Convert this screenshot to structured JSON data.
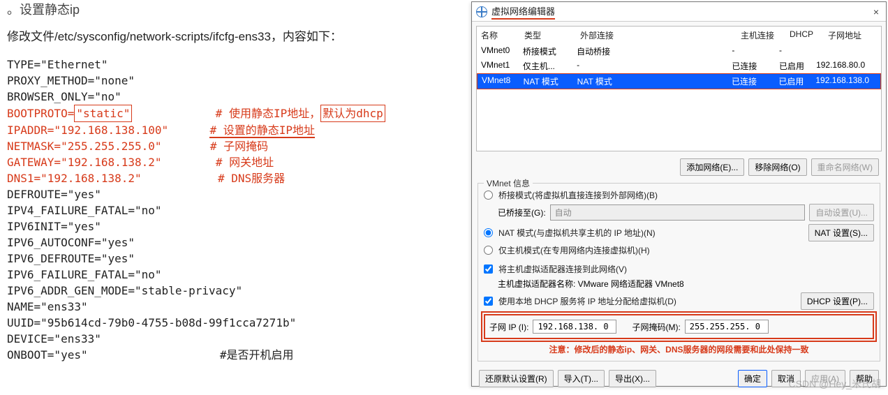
{
  "left": {
    "heading_partial": "设置静态ip",
    "intro": "修改文件/etc/sysconfig/network-scripts/ifcfg-ens33，内容如下：",
    "lines": {
      "l1": "TYPE=\"Ethernet\"",
      "l2": "PROXY_METHOD=\"none\"",
      "l3": "BROWSER_ONLY=\"no\"",
      "l4a": "BOOTPROTO=",
      "l4b": "\"static\"",
      "l4c": "# 使用静态IP地址，",
      "l4d": "默认为dhcp",
      "l5": "IPADDR=\"192.168.138.100\"",
      "l5c": "# 设置的静态IP地址",
      "l6": "NETMASK=\"255.255.255.0\"",
      "l6c": "# 子网掩码",
      "l7": "GATEWAY=\"192.168.138.2\"",
      "l7c": "# 网关地址",
      "l8": "DNS1=\"192.168.138.2\"",
      "l8c": "# DNS服务器",
      "l9": "DEFROUTE=\"yes\"",
      "l10": "IPV4_FAILURE_FATAL=\"no\"",
      "l11": "IPV6INIT=\"yes\"",
      "l12": "IPV6_AUTOCONF=\"yes\"",
      "l13": "IPV6_DEFROUTE=\"yes\"",
      "l14": "IPV6_FAILURE_FATAL=\"no\"",
      "l15": "IPV6_ADDR_GEN_MODE=\"stable-privacy\"",
      "l16": "NAME=\"ens33\"",
      "l17": "UUID=\"95b614cd-79b0-4755-b08d-99f1cca7271b\"",
      "l18": "DEVICE=\"ens33\"",
      "l19": "ONBOOT=\"yes\"",
      "l19c": "#是否开机启用"
    }
  },
  "dialog": {
    "title": "虚拟网络编辑器",
    "close": "×",
    "columns": {
      "name": "名称",
      "type": "类型",
      "ext": "外部连接",
      "host": "主机连接",
      "dhcp": "DHCP",
      "sub": "子网地址"
    },
    "rows": [
      {
        "name": "VMnet0",
        "type": "桥接模式",
        "ext": "自动桥接",
        "host": "-",
        "dhcp": "-",
        "sub": ""
      },
      {
        "name": "VMnet1",
        "type": "仅主机...",
        "ext": "-",
        "host": "已连接",
        "dhcp": "已启用",
        "sub": "192.168.80.0"
      },
      {
        "name": "VMnet8",
        "type": "NAT 模式",
        "ext": "NAT 模式",
        "host": "已连接",
        "dhcp": "已启用",
        "sub": "192.168.138.0"
      }
    ],
    "add_net": "添加网络(E)...",
    "remove_net": "移除网络(O)",
    "rename_net": "重命名网络(W)",
    "group_title": "VMnet 信息",
    "radio_bridge": "桥接模式(将虚拟机直接连接到外部网络)(B)",
    "bridge_to_label": "已桥接至(G):",
    "bridge_to_value": "自动",
    "auto_set": "自动设置(U)...",
    "radio_nat": "NAT 模式(与虚拟机共享主机的 IP 地址)(N)",
    "nat_set": "NAT 设置(S)...",
    "radio_host": "仅主机模式(在专用网络内连接虚拟机)(H)",
    "check_host_adapter": "将主机虚拟适配器连接到此网络(V)",
    "host_adapter_name": "主机虚拟适配器名称: VMware 网络适配器 VMnet8",
    "check_dhcp": "使用本地 DHCP 服务将 IP 地址分配给虚拟机(D)",
    "dhcp_set": "DHCP 设置(P)...",
    "subnet_ip_label": "子网 IP (I):",
    "subnet_ip_value": "192.168.138. 0",
    "subnet_mask_label": "子网掩码(M):",
    "subnet_mask_value": "255.255.255. 0",
    "note": "注意：修改后的静态ip、网关、DNS服务器的网段需要和此处保持一致",
    "restore": "还原默认设置(R)",
    "import": "导入(T)...",
    "export": "导出(X)...",
    "ok": "确定",
    "cancel": "取消",
    "apply": "应用(A)",
    "help": "帮助"
  },
  "watermark": "CSDN @Hey_米氏胡"
}
